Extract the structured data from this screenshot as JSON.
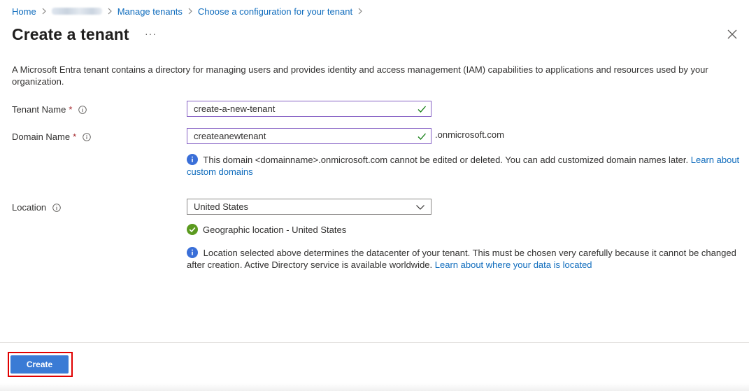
{
  "breadcrumb": {
    "home": "Home",
    "manage_tenants": "Manage tenants",
    "choose_config": "Choose a configuration for your tenant"
  },
  "header": {
    "title": "Create a tenant",
    "more": "···"
  },
  "description": "A Microsoft Entra tenant contains a directory for managing users and provides identity and access management (IAM) capabilities to applications and resources used by your organization.",
  "form": {
    "tenant_name": {
      "label": "Tenant Name",
      "required_mark": "*",
      "value": "create-a-new-tenant"
    },
    "domain_name": {
      "label": "Domain Name",
      "required_mark": "*",
      "value": "createanewtenant",
      "suffix": ".onmicrosoft.com",
      "info_text": "This domain <domainname>.onmicrosoft.com cannot be edited or deleted. You can add customized domain names later.",
      "info_link": "Learn about custom domains"
    },
    "location": {
      "label": "Location",
      "selected": "United States",
      "geo_status": "Geographic location - United States",
      "info_text": "Location selected above determines the datacenter of your tenant. This must be chosen very carefully because it cannot be changed after creation. Active Directory service is available worldwide.",
      "info_link": "Learn about where your data is located"
    }
  },
  "footer": {
    "create_label": "Create"
  },
  "colors": {
    "link": "#0f6cbd",
    "input_border_valid": "#8661c5",
    "check_green": "#107c10",
    "info_blue": "#3a6fd8",
    "primary_button": "#3a7bd5",
    "highlight": "#e00000"
  },
  "icons": {
    "breadcrumb_separator": "chevron-right-icon",
    "close": "close-icon",
    "field_info": "info-circle-icon",
    "valid": "checkmark-icon",
    "info_badge": "info-filled-icon",
    "success_badge": "check-circle-icon",
    "dropdown": "chevron-down-icon"
  }
}
